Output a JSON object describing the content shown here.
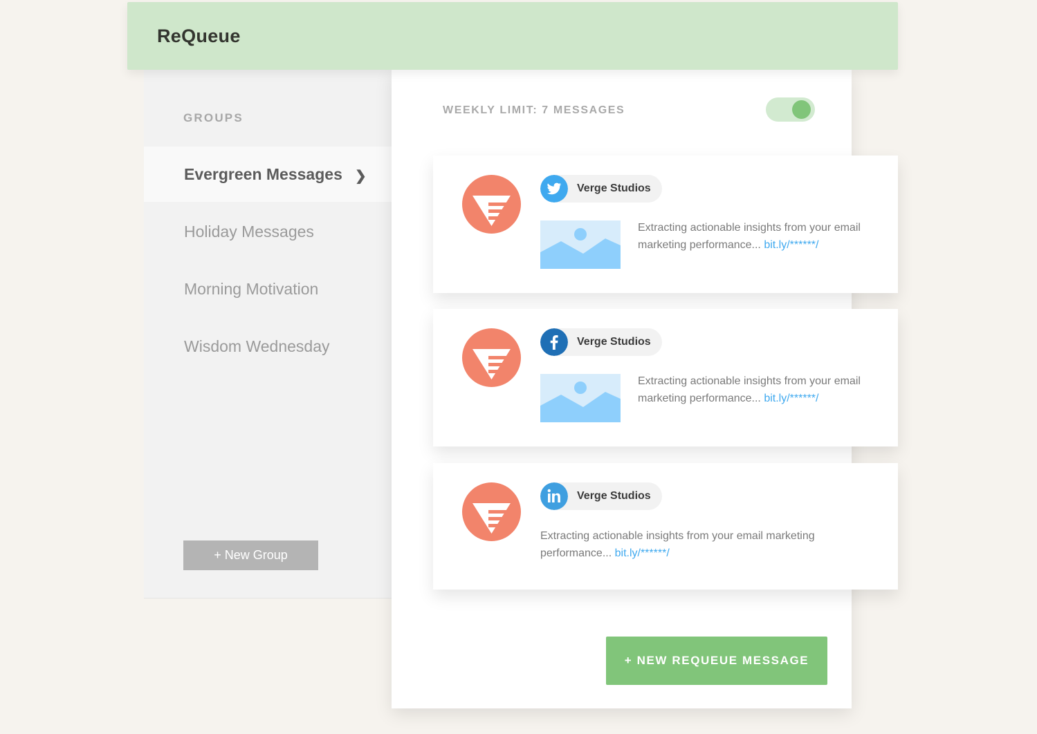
{
  "app": {
    "title": "ReQueue"
  },
  "sidebar": {
    "heading": "GROUPS",
    "items": [
      {
        "label": "Evergreen Messages",
        "active": true
      },
      {
        "label": "Holiday Messages",
        "active": false
      },
      {
        "label": "Morning Motivation",
        "active": false
      },
      {
        "label": "Wisdom Wednesday",
        "active": false
      }
    ],
    "chevron": "❯",
    "new_group_label": "+ New Group"
  },
  "main": {
    "weekly_limit": "WEEKLY LIMIT: 7 MESSAGES",
    "toggle_on": true,
    "messages": [
      {
        "network": "twitter",
        "icon": "twitter-icon",
        "account": "Verge Studios",
        "has_image": true,
        "text": "Extracting actionable insights from your email marketing performance...",
        "link": "bit.ly/******/"
      },
      {
        "network": "facebook",
        "icon": "facebook-icon",
        "account": "Verge Studios",
        "has_image": true,
        "text": "Extracting actionable insights from your email marketing performance...",
        "link": "bit.ly/******/"
      },
      {
        "network": "linkedin",
        "icon": "linkedin-icon",
        "account": "Verge Studios",
        "has_image": false,
        "text": "Extracting actionable insights from your email marketing performance...",
        "link": "bit.ly/******/"
      }
    ],
    "new_message_label": "+ NEW REQUEUE MESSAGE"
  },
  "colors": {
    "header_bg": "#cfe7cb",
    "accent_green": "#81c57a",
    "brand_orange": "#f2846b",
    "link_blue": "#3fa9ef",
    "twitter_blue": "#3fa9ef",
    "facebook_blue": "#1f6fb5",
    "linkedin_blue": "#3f9fe0"
  }
}
